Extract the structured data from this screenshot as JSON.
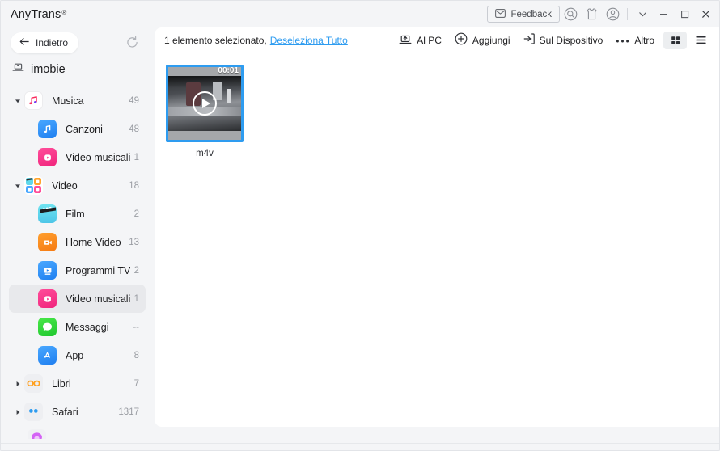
{
  "window": {
    "brand": "AnyTrans",
    "brand_sup": "®",
    "feedback_label": "Feedback",
    "icons": {
      "feedback": "envelope-icon",
      "search": "search-icon",
      "gift": "tshirt-icon",
      "account": "account-icon",
      "chevron": "chevron-down-icon",
      "minimize": "minimize-icon",
      "maximize": "maximize-icon",
      "close": "close-icon"
    }
  },
  "sidebar": {
    "back_label": "Indietro",
    "refresh_label": "refresh-icon",
    "device_name": "imobie",
    "items": [
      {
        "label": "Musica",
        "count": "49",
        "caret": "down",
        "level": 0,
        "icon": "music-note-icon",
        "selected": false
      },
      {
        "label": "Canzoni",
        "count": "48",
        "caret": "none",
        "level": 1,
        "icon": "songs-icon",
        "selected": false
      },
      {
        "label": "Video musicali",
        "count": "1",
        "caret": "none",
        "level": 1,
        "icon": "music-video-icon",
        "selected": false
      },
      {
        "label": "Video",
        "count": "18",
        "caret": "down",
        "level": 0,
        "icon": "video-grid-icon",
        "selected": false
      },
      {
        "label": "Film",
        "count": "2",
        "caret": "none",
        "level": 1,
        "icon": "film-icon",
        "selected": false
      },
      {
        "label": "Home Video",
        "count": "13",
        "caret": "none",
        "level": 1,
        "icon": "home-video-icon",
        "selected": false
      },
      {
        "label": "Programmi TV",
        "count": "2",
        "caret": "none",
        "level": 1,
        "icon": "tv-shows-icon",
        "selected": false
      },
      {
        "label": "Video musicali",
        "count": "1",
        "caret": "none",
        "level": 1,
        "icon": "music-video-icon",
        "selected": true
      },
      {
        "label": "Messaggi",
        "count": "--",
        "caret": "none",
        "level": 0,
        "icon": "messages-icon",
        "selected": false
      },
      {
        "label": "App",
        "count": "8",
        "caret": "none",
        "level": 0,
        "icon": "appstore-icon",
        "selected": false
      },
      {
        "label": "Libri",
        "count": "7",
        "caret": "right",
        "level": 0,
        "icon": "books-icon",
        "selected": false
      },
      {
        "label": "Safari",
        "count": "1317",
        "caret": "right",
        "level": 0,
        "icon": "safari-icon",
        "selected": false
      }
    ]
  },
  "toolbar": {
    "selection_text": "1 elemento selezionato,",
    "deselect_link": "Deseleziona Tutto",
    "actions": [
      {
        "label": "Al PC",
        "icon": "export-to-pc-icon"
      },
      {
        "label": "Aggiungi",
        "icon": "plus-circle-icon"
      },
      {
        "label": "Sul Dispositivo",
        "icon": "to-device-icon"
      },
      {
        "label": "Altro",
        "icon": "more-dots-icon"
      }
    ],
    "views": [
      {
        "name": "grid-view-icon",
        "active": true
      },
      {
        "name": "list-view-icon",
        "active": false
      }
    ]
  },
  "content": {
    "items": [
      {
        "label": "m4v",
        "duration": "00:01",
        "selected": true
      }
    ]
  },
  "colors": {
    "accent": "#2e9cf0",
    "window_bg": "#f4f5f7",
    "panel_bg": "#ffffff",
    "selected_row": "#e8e9ec",
    "text": "#1d1d1f",
    "muted": "#9a9da3"
  }
}
